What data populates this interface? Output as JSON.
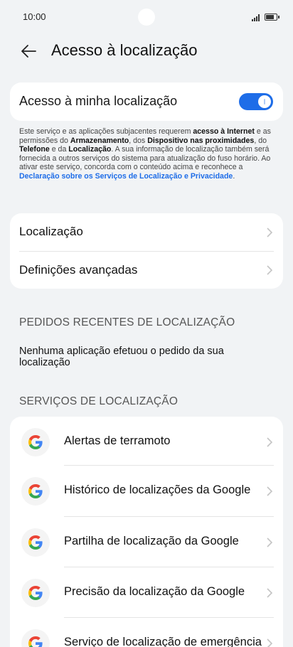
{
  "status_bar": {
    "time": "10:00"
  },
  "header": {
    "title": "Acesso à localização"
  },
  "location_toggle": {
    "label": "Acesso à minha localização",
    "enabled": true,
    "accent": "#1e6de8"
  },
  "disclaimer": {
    "t1": "Este serviço e as aplicações subjacentes requerem ",
    "b1": "acesso à Internet",
    "t2": " e as permissões do ",
    "b2": "Armazenamento",
    "t3": ", dos ",
    "b3": "Dispositivo nas proximidades",
    "t4": ", do ",
    "b4": "Telefone",
    "t5": " e da ",
    "b5": "Localização",
    "t6": ". A sua informação de localização também será fornecida a outros serviços do sistema para atualização do fuso horário. Ao ativar este serviço, concorda com o conteúdo acima e reconhece a ",
    "link": "Declaração sobre os Serviços de Localização e Privacidade",
    "t7": "."
  },
  "menu": {
    "items": [
      {
        "label": "Localização"
      },
      {
        "label": "Definições avançadas"
      }
    ]
  },
  "recent_requests": {
    "header": "PEDIDOS RECENTES DE LOCALIZAÇÃO",
    "empty_text": "Nenhuma aplicação efetuou o pedido da sua localização"
  },
  "services": {
    "header": "SERVIÇOS DE LOCALIZAÇÃO",
    "items": [
      {
        "label": "Alertas de terramoto",
        "icon": "google-icon"
      },
      {
        "label": "Histórico de localizações da Google",
        "icon": "google-icon"
      },
      {
        "label": "Partilha de localização da Google",
        "icon": "google-icon"
      },
      {
        "label": "Precisão da localização da Google",
        "icon": "google-icon"
      },
      {
        "label": "Serviço de localização de emergência",
        "icon": "google-icon"
      }
    ]
  }
}
